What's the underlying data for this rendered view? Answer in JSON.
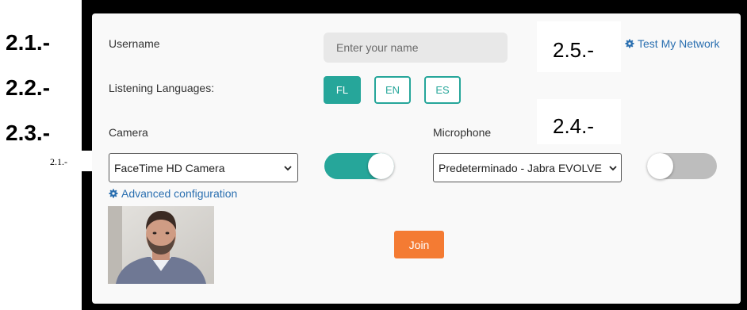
{
  "annotations": {
    "left_21": "2.1.-",
    "left_22": "2.2.-",
    "left_23": "2.3.-",
    "small_21": "2.1.-",
    "box_25": "2.5.-",
    "box_24": "2.4.-"
  },
  "form": {
    "username_label": "Username",
    "username_placeholder": "Enter your name",
    "username_value": "",
    "listening_label": "Listening Languages:",
    "languages": [
      {
        "label": "FL",
        "active": true
      },
      {
        "label": "EN",
        "active": false
      },
      {
        "label": "ES",
        "active": false
      }
    ],
    "camera_label": "Camera",
    "camera_selected": "FaceTime HD Camera",
    "camera_enabled": true,
    "microphone_label": "Microphone",
    "microphone_selected": "Predeterminado - Jabra EVOLVE",
    "microphone_enabled": false,
    "advanced_config_link": "Advanced configuration",
    "test_network_link": "Test My Network",
    "join_label": "Join"
  },
  "icons": {
    "advanced_config": "gear-icon",
    "test_network": "gear-icon",
    "select_chevron": "chevron-down-icon"
  },
  "colors": {
    "accent": "#26a69a",
    "join": "#f47b33",
    "link": "#2a6fb0",
    "toggle_off": "#bdbdbd"
  }
}
